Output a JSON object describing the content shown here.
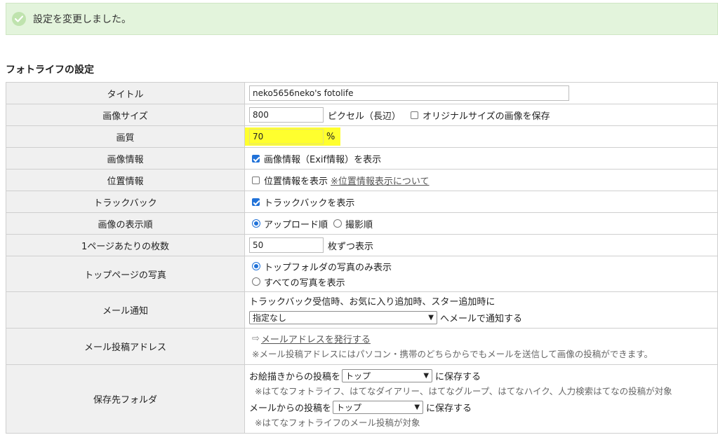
{
  "notice": {
    "text": "設定を変更しました。"
  },
  "section_title": "フォトライフの設定",
  "rows": {
    "title": {
      "label": "タイトル",
      "value": "neko5656neko's fotolife"
    },
    "image_size": {
      "label": "画像サイズ",
      "value": "800",
      "unit": "ピクセル（長辺）",
      "checkbox_label": "オリジナルサイズの画像を保存",
      "checkbox_checked": false
    },
    "quality": {
      "label": "画質",
      "value": "70",
      "unit": "%"
    },
    "image_info": {
      "label": "画像情報",
      "checkbox_label": "画像情報（Exif情報）を表示",
      "checkbox_checked": true
    },
    "location": {
      "label": "位置情報",
      "checkbox_label": "位置情報を表示",
      "checkbox_checked": false,
      "link": "※位置情報表示について"
    },
    "trackback": {
      "label": "トラックバック",
      "checkbox_label": "トラックバックを表示",
      "checkbox_checked": true
    },
    "order": {
      "label": "画像の表示順",
      "option1": "アップロード順",
      "option2": "撮影順",
      "selected": "アップロード順"
    },
    "per_page": {
      "label": "1ページあたりの枚数",
      "value": "50",
      "unit": "枚ずつ表示"
    },
    "top_photo": {
      "label": "トップページの写真",
      "option1": "トップフォルダの写真のみ表示",
      "option2": "すべての写真を表示",
      "selected": "トップフォルダの写真のみ表示"
    },
    "mail_notify": {
      "label": "メール通知",
      "description": "トラックバック受信時、お気に入り追加時、スター追加時に",
      "select_value": "指定なし",
      "suffix": "へメールで通知する"
    },
    "mail_post": {
      "label": "メール投稿アドレス",
      "arrow": "⇨",
      "link": "メールアドレスを発行する",
      "note": "※メール投稿アドレスにはパソコン・携帯のどちらからでもメールを送信して画像の投稿ができます。"
    },
    "save_folder": {
      "label": "保存先フォルダ",
      "line1_prefix": "お絵描きからの投稿を",
      "line1_select": "トップ",
      "line1_suffix": "に保存する",
      "note1": "※はてなフォトライフ、はてなダイアリー、はてなグループ、はてなハイク、人力検索はてなの投稿が対象",
      "line2_prefix": "メールからの投稿を",
      "line2_select": "トップ",
      "line2_suffix": "に保存する",
      "note2": "※はてなフォトライフのメール投稿が対象"
    }
  },
  "colors": {
    "notice_bg": "#e3f4dc",
    "label_bg": "#f0f0f0",
    "highlight": "#ffff2e",
    "accent": "#2172d8"
  }
}
